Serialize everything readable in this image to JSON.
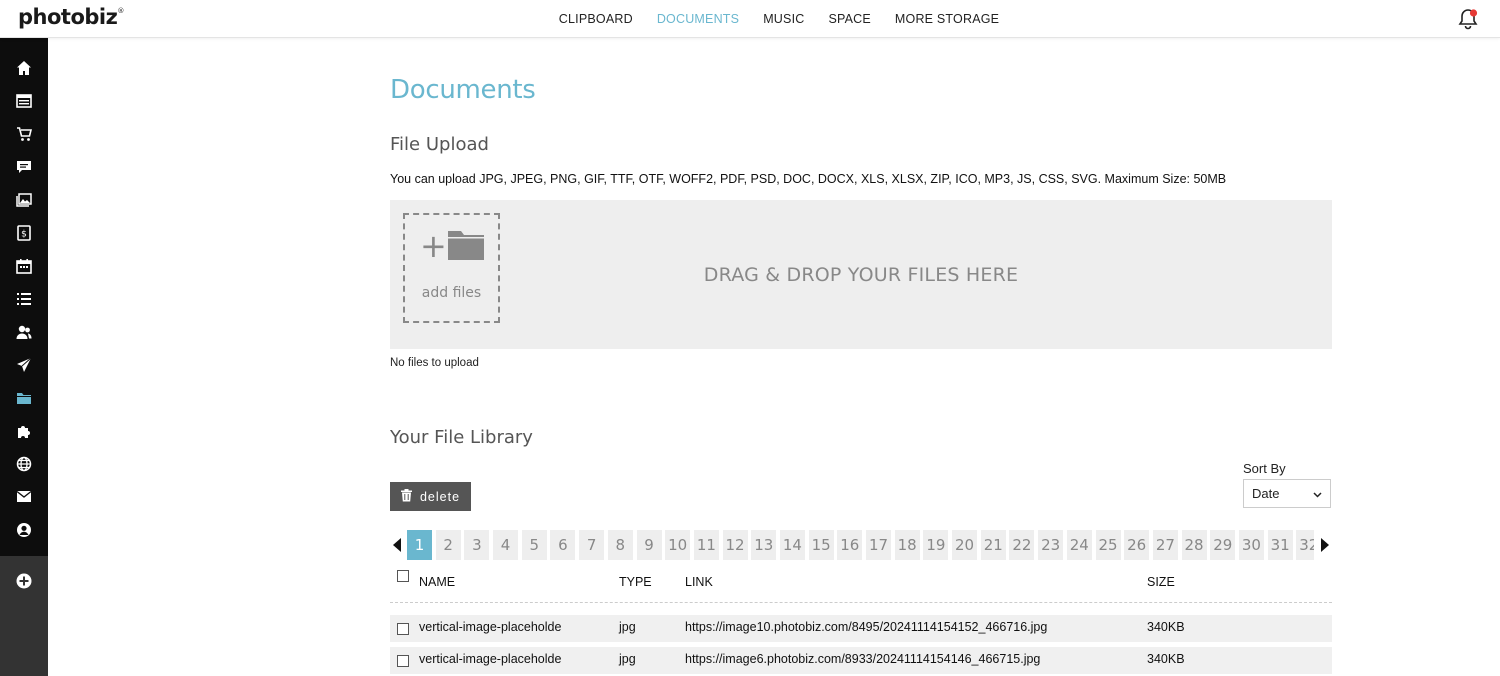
{
  "brand": {
    "logo_text": "photobiz",
    "logo_mark": "®"
  },
  "topnav": {
    "items": [
      {
        "label": "CLIPBOARD",
        "active": false
      },
      {
        "label": "DOCUMENTS",
        "active": true
      },
      {
        "label": "MUSIC",
        "active": false
      },
      {
        "label": "SPACE",
        "active": false
      },
      {
        "label": "MORE STORAGE",
        "active": false
      }
    ]
  },
  "sidebar": {
    "icons": [
      "home-icon",
      "website-icon",
      "cart-icon",
      "chat-icon",
      "gallery-icon",
      "invoice-icon",
      "calendar-icon",
      "list-icon",
      "contacts-icon",
      "send-icon",
      "folder-icon",
      "puzzle-icon",
      "globe-icon",
      "mail-icon",
      "account-icon"
    ],
    "add_icon": "plus-circle-icon"
  },
  "page": {
    "title": "Documents",
    "upload": {
      "title": "File Upload",
      "allowed": "You can upload JPG, JPEG, PNG, GIF, TTF, OTF, WOFF2, PDF, PSD, DOC, DOCX, XLS, XLSX, ZIP, ICO, MP3, JS, CSS, SVG. Maximum Size: 50MB",
      "add_files_label": "add files",
      "drop_text": "DRAG & DROP YOUR FILES HERE",
      "status": "No files to upload"
    },
    "library": {
      "title": "Your File Library",
      "delete_label": "delete",
      "sort_label": "Sort By",
      "sort_value": "Date",
      "pages": [
        "1",
        "2",
        "3",
        "4",
        "5",
        "6",
        "7",
        "8",
        "9",
        "10",
        "11",
        "12",
        "13",
        "14",
        "15",
        "16",
        "17",
        "18",
        "19",
        "20",
        "21",
        "22",
        "23",
        "24",
        "25",
        "26",
        "27",
        "28",
        "29",
        "30",
        "31",
        "32"
      ],
      "current_page": "1",
      "columns": {
        "name": "NAME",
        "type": "TYPE",
        "link": "LINK",
        "size": "SIZE"
      },
      "rows": [
        {
          "name": "vertical-image-placeholde",
          "type": "jpg",
          "link": "https://image10.photobiz.com/8495/20241114154152_466716.jpg",
          "size": "340KB"
        },
        {
          "name": "vertical-image-placeholde",
          "type": "jpg",
          "link": "https://image6.photobiz.com/8933/20241114154146_466715.jpg",
          "size": "340KB"
        }
      ]
    }
  },
  "colors": {
    "accent": "#6ab7cf",
    "sidebar": "#0d0d0d",
    "notification_dot": "#e53935"
  }
}
